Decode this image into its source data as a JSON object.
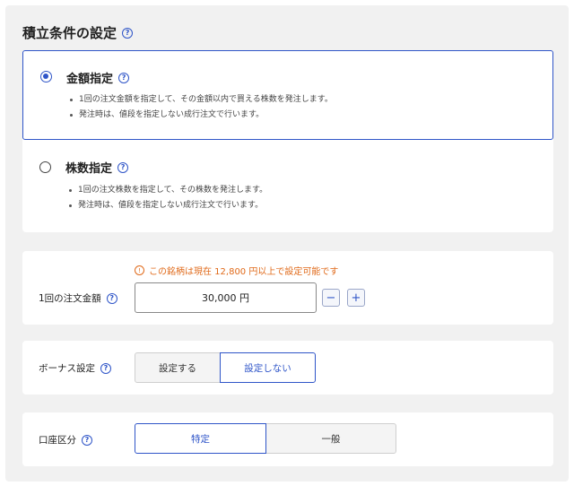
{
  "page": {
    "title": "積立条件の設定",
    "help_icon": "?"
  },
  "order_type": {
    "options": [
      {
        "label": "金額指定",
        "selected": true,
        "notes": [
          "1回の注文金額を指定して、その金額以内で買える株数を発注します。",
          "発注時は、値段を指定しない成行注文で行います。"
        ]
      },
      {
        "label": "株数指定",
        "selected": false,
        "notes": [
          "1回の注文株数を指定して、その株数を発注します。",
          "発注時は、値段を指定しない成行注文で行います。"
        ]
      }
    ]
  },
  "amount": {
    "label": "1回の注文金額",
    "notice_icon": "!",
    "notice": "この銘柄は現在 12,800 円以上で設定可能です",
    "value": "30,000 円",
    "minus": "−",
    "plus": "+"
  },
  "bonus": {
    "label": "ボーナス設定",
    "options": [
      "設定する",
      "設定しない"
    ],
    "selected": "設定しない"
  },
  "account": {
    "label": "口座区分",
    "options": [
      "特定",
      "一般"
    ],
    "selected": "特定"
  },
  "colors": {
    "accent": "#2f55c8",
    "warning": "#e06a1a",
    "background": "#f1f1f1"
  }
}
